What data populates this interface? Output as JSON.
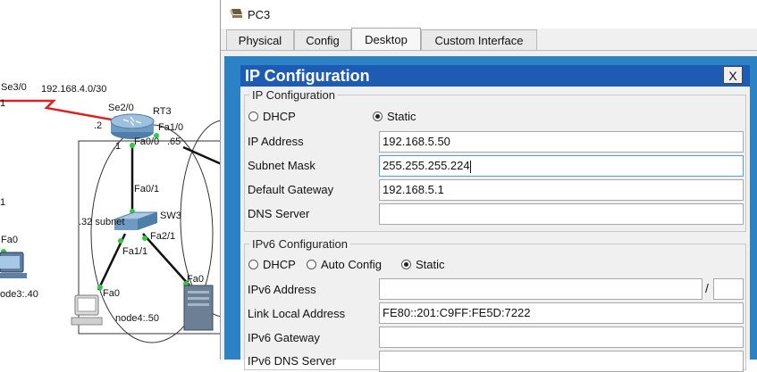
{
  "topology": {
    "link_rt3_west": {
      "port_left": "Se3/0",
      "network": "192.168.4.0/30",
      "left_host": "1",
      "port_right": "Se2/0",
      "right_host": ".2"
    },
    "router": {
      "name": "RT3",
      "fa0_0": "Fa0/0",
      "fa1_0": "Fa1/0",
      "host_fa0_0": ".1",
      "host_fa1_0": ".65"
    },
    "switch": {
      "name": "SW3",
      "fa0_1": "Fa0/1",
      "fa1_1": "Fa1/1",
      "fa2_1": "Fa2/1",
      "subnet_note": ".32 subnet"
    },
    "edge_left": {
      "label_1": "1",
      "port": "Fa0",
      "node_label": "ode3:.40"
    },
    "node4": {
      "port": "Fa0",
      "label": "node4:.50"
    },
    "server": {
      "port": "Fa0"
    },
    "colors": {
      "serial_link": "#e02020",
      "ethernet_link": "#111111",
      "port_up": "#2ecc40"
    }
  },
  "window": {
    "title": "PC3",
    "icon": "pc-icon",
    "tabs": [
      "Physical",
      "Config",
      "Desktop",
      "Custom Interface"
    ],
    "active_tab": "Desktop"
  },
  "ip_config": {
    "title": "IP Configuration",
    "close_label": "X",
    "ipv4_section": "IP Configuration",
    "dhcp_label": "DHCP",
    "static_label": "Static",
    "mode": "Static",
    "ip_address_label": "IP Address",
    "ip_address": "192.168.5.50",
    "subnet_mask_label": "Subnet Mask",
    "subnet_mask": "255.255.255.224",
    "default_gateway_label": "Default Gateway",
    "default_gateway": "192.168.5.1",
    "dns_server_label": "DNS Server",
    "dns_server": "",
    "ipv6_section": "IPv6 Configuration",
    "ipv6_dhcp_label": "DHCP",
    "ipv6_auto_label": "Auto Config",
    "ipv6_static_label": "Static",
    "ipv6_mode": "Static",
    "ipv6_address_label": "IPv6 Address",
    "ipv6_address": "",
    "ipv6_prefix_sep": "/",
    "ipv6_prefix": "",
    "link_local_label": "Link Local Address",
    "link_local": "FE80::201:C9FF:FE5D:7222",
    "ipv6_gateway_label": "IPv6 Gateway",
    "ipv6_gateway": "",
    "ipv6_dns_label": "IPv6 DNS Server"
  },
  "colors": {
    "dialog_title_bg": "#1e5bb3",
    "desktop_bg": "#2b83c6",
    "window_bg": "#f0f0f0"
  }
}
